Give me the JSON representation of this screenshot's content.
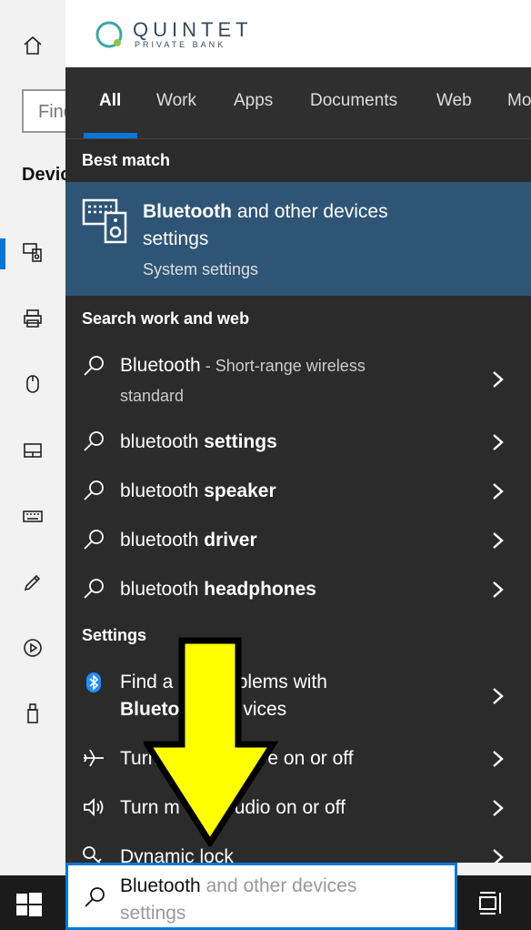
{
  "background": {
    "find_placeholder": "Find",
    "section_title": "Devic"
  },
  "logo": {
    "main": "QUINTET",
    "sub": "PRIVATE BANK"
  },
  "tabs": [
    "All",
    "Work",
    "Apps",
    "Documents",
    "Web",
    "Mo"
  ],
  "best_match": {
    "section": "Best match",
    "title_bold": "Bluetooth",
    "title_rest": " and other devices settings",
    "subtitle": "System settings"
  },
  "search_web": {
    "section": "Search work and web",
    "items": [
      {
        "prefix": "Bluetooth",
        "bold": "",
        "desc": " - Short-range wireless",
        "desc2": "standard"
      },
      {
        "prefix": "bluetooth ",
        "bold": "settings"
      },
      {
        "prefix": "bluetooth ",
        "bold": "speaker"
      },
      {
        "prefix": "bluetooth ",
        "bold": "driver"
      },
      {
        "prefix": "bluetooth ",
        "bold": "headphones"
      }
    ]
  },
  "settings": {
    "section": "Settings",
    "items": [
      {
        "line1": "Find a",
        "line1b": "problems with",
        "line2_bold": "Blueto",
        "line2_rest": "vices"
      },
      {
        "text1": "Turn",
        "text2": "e on or off"
      },
      {
        "text1": "Turn m",
        "text2": "udio on or off"
      },
      {
        "text1": "Dynamic lock",
        "text2": ""
      }
    ]
  },
  "search_box": {
    "typed": "Bluetooth",
    "suggestion": " and other devices settings"
  },
  "colors": {
    "accent": "#0078d7",
    "panel_bg": "#2b2b2b",
    "best_match_bg": "#2e5575",
    "arrow": "#ffff00"
  }
}
